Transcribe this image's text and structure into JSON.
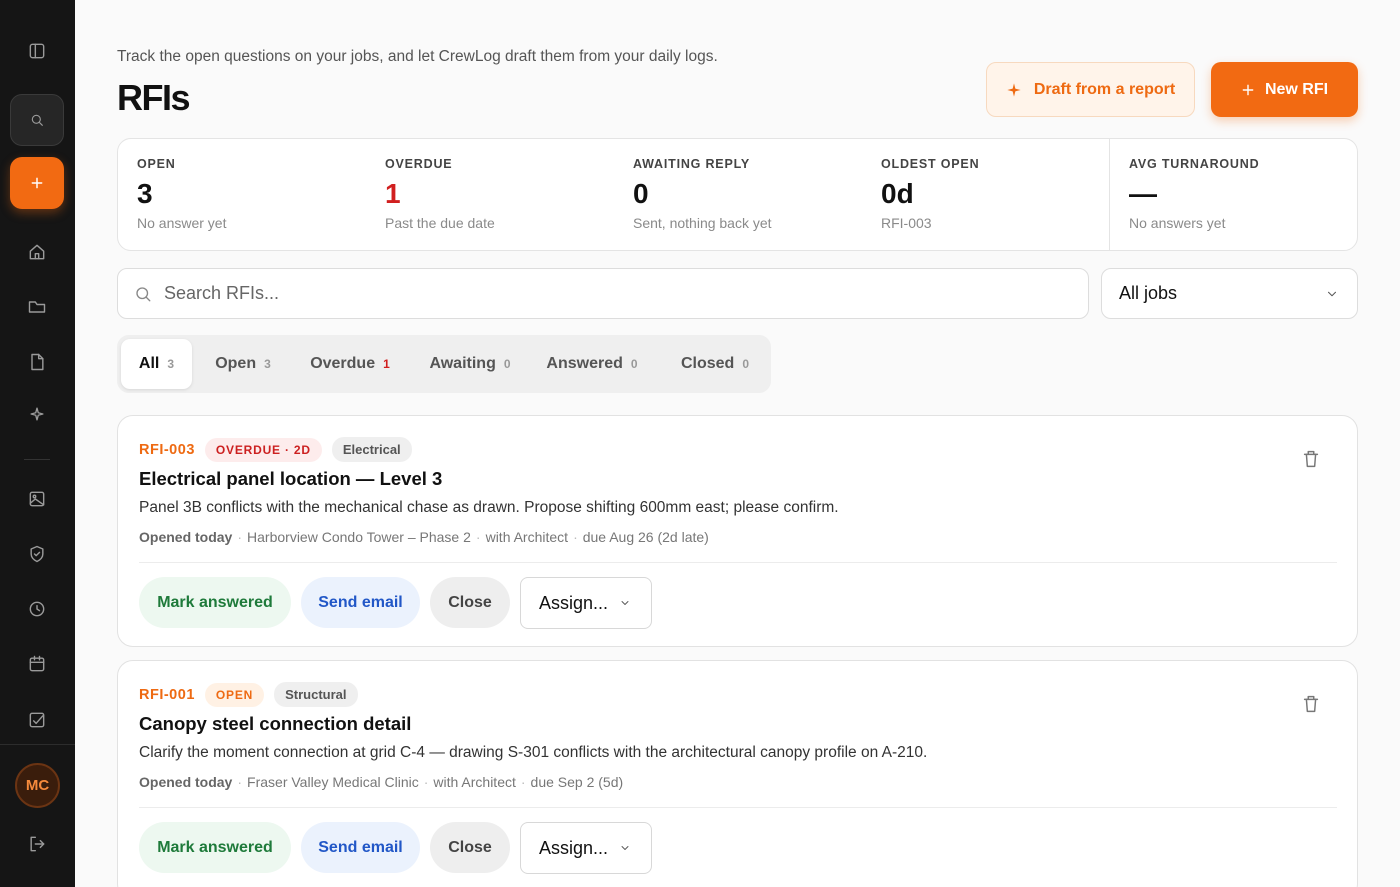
{
  "header": {
    "subtitle": "Track the open questions on your jobs, and let CrewLog draft them from your daily logs.",
    "title": "RFIs",
    "draft_button": "Draft from a report",
    "new_button": "New RFI"
  },
  "stats": [
    {
      "label": "OPEN",
      "value": "3",
      "note": "No answer yet"
    },
    {
      "label": "OVERDUE",
      "value": "1",
      "note": "Past the due date"
    },
    {
      "label": "AWAITING REPLY",
      "value": "0",
      "note": "Sent, nothing back yet"
    },
    {
      "label": "OLDEST OPEN",
      "value": "0d",
      "note": "RFI-003"
    },
    {
      "label": "AVG TURNAROUND",
      "value": "—",
      "note": "No answers yet"
    }
  ],
  "search": {
    "placeholder": "Search RFIs..."
  },
  "jobs_filter": {
    "selected": "All jobs"
  },
  "tabs": [
    {
      "label": "All",
      "count": "3"
    },
    {
      "label": "Open",
      "count": "3"
    },
    {
      "label": "Overdue",
      "count": "1"
    },
    {
      "label": "Awaiting",
      "count": "0"
    },
    {
      "label": "Answered",
      "count": "0"
    },
    {
      "label": "Closed",
      "count": "0"
    }
  ],
  "rfis": [
    {
      "id": "RFI-003",
      "status": "OVERDUE · 2D",
      "category": "Electrical",
      "title": "Electrical panel location — Level 3",
      "description": "Panel 3B conflicts with the mechanical chase as drawn. Propose shifting 600mm east; please confirm.",
      "opened": "Opened today",
      "job": "Harborview Condo Tower – Phase 2",
      "with": "with Architect",
      "due": "due Aug 26 (2d late)"
    },
    {
      "id": "RFI-001",
      "status": "OPEN",
      "category": "Structural",
      "title": "Canopy steel connection detail",
      "description": "Clarify the moment connection at grid C-4 — drawing S-301 conflicts with the architectural canopy profile on A-210.",
      "opened": "Opened today",
      "job": "Fraser Valley Medical Clinic",
      "with": "with Architect",
      "due": "due Sep 2 (5d)"
    }
  ],
  "actions": {
    "mark_answered": "Mark answered",
    "send_email": "Send email",
    "close": "Close",
    "assign": "Assign..."
  },
  "user": {
    "initials": "MC"
  },
  "colors": {
    "accent": "#f26a12",
    "danger": "#d11f1f",
    "success": "#1e7a3a",
    "info": "#2157c7",
    "sidebar": "#151515"
  }
}
